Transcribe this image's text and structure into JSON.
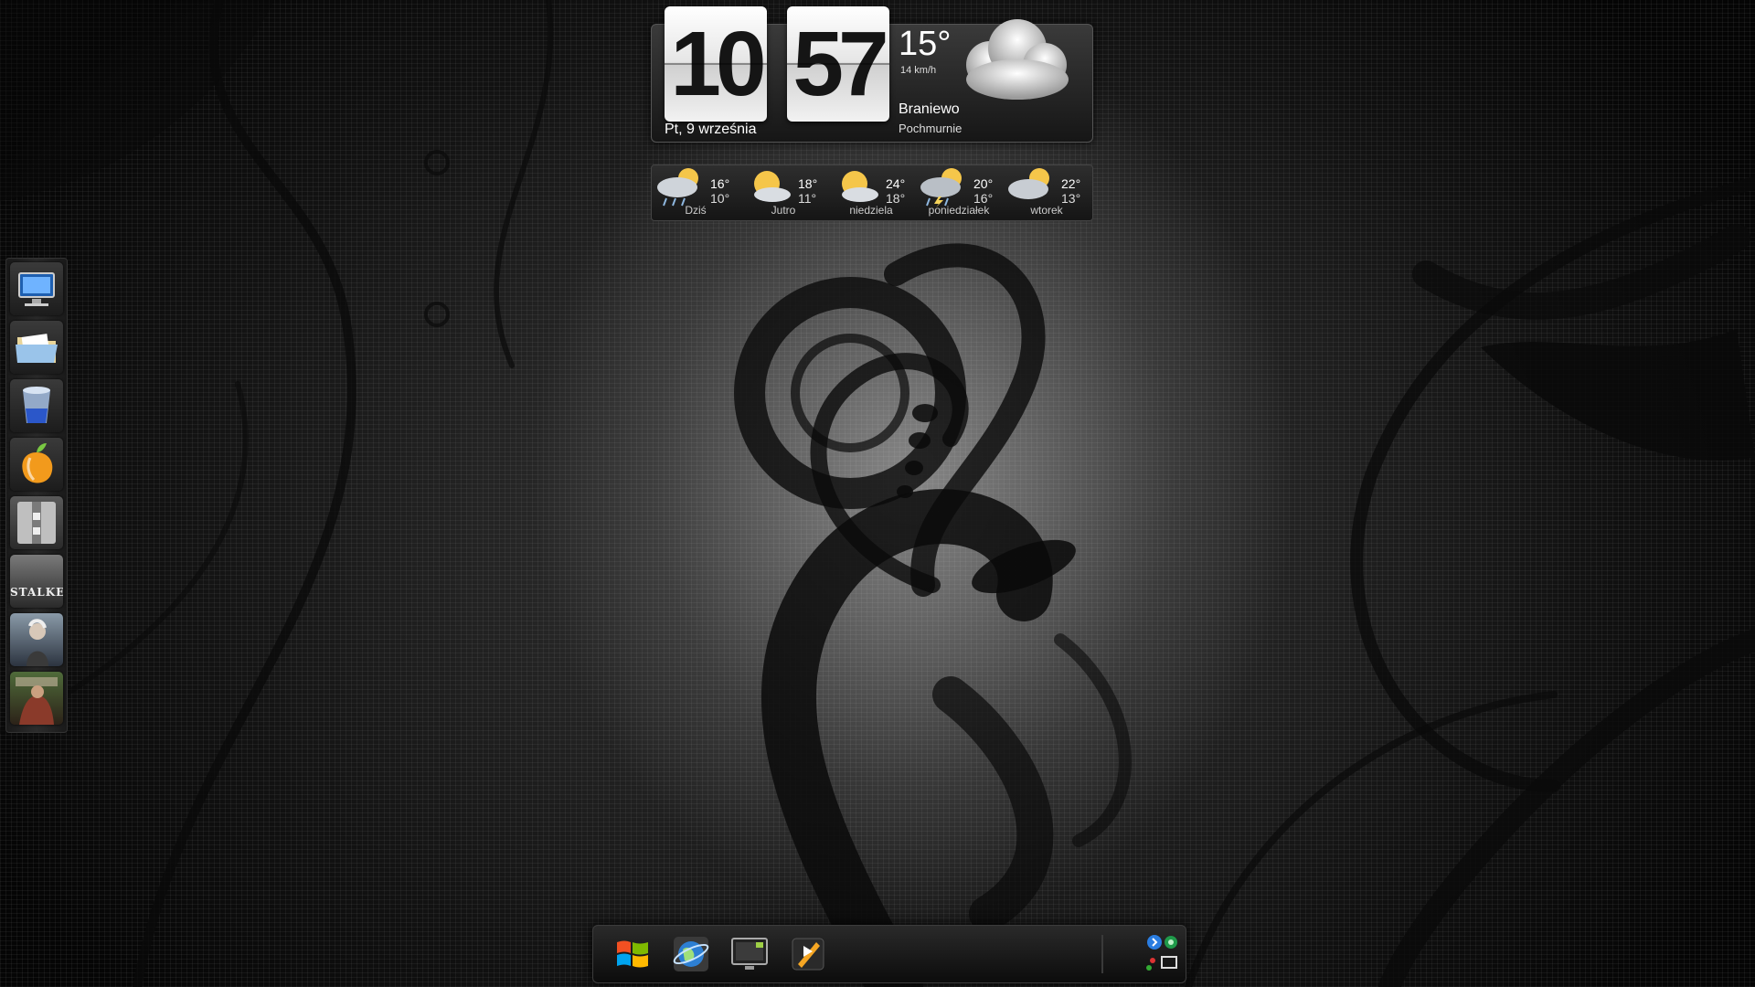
{
  "clock": {
    "hour": "10",
    "minute": "57",
    "date": "Pt, 9 września"
  },
  "weather": {
    "temperature": "15°",
    "wind": "14 km/h",
    "city": "Braniewo",
    "condition": "Pochmurnie",
    "icon": "cloud-icon"
  },
  "forecast": [
    {
      "day": "Dziś",
      "high": "16°",
      "low": "10°",
      "icon": "rain-sun-icon"
    },
    {
      "day": "Jutro",
      "high": "18°",
      "low": "11°",
      "icon": "partly-sunny-icon"
    },
    {
      "day": "niedziela",
      "high": "24°",
      "low": "18°",
      "icon": "partly-sunny-icon"
    },
    {
      "day": "poniedziałek",
      "high": "20°",
      "low": "16°",
      "icon": "storm-sun-icon"
    },
    {
      "day": "wtorek",
      "high": "22°",
      "low": "13°",
      "icon": "cloud-sun-icon"
    }
  ],
  "launcher": {
    "items": [
      {
        "name": "computer-icon",
        "text": ""
      },
      {
        "name": "folder-icon",
        "text": ""
      },
      {
        "name": "recycle-bin-icon",
        "text": ""
      },
      {
        "name": "fl-studio-icon",
        "text": ""
      },
      {
        "name": "zipper-icon",
        "text": ""
      },
      {
        "name": "stalker-game-icon",
        "text": "STALKER"
      },
      {
        "name": "witcher-game-icon",
        "text": ""
      },
      {
        "name": "dead-island-game-icon",
        "text": ""
      }
    ]
  },
  "dock": {
    "items": [
      "windows-start-icon",
      "globe-browser-icon",
      "monitor-icon",
      "media-player-icon"
    ],
    "tray": [
      "shortcut-icon",
      "network-icon"
    ]
  },
  "colors": {
    "background": "#1a1a1a",
    "widget_dark": "#161616",
    "flip_card": "#f2f2f2",
    "text": "#ffffff"
  }
}
